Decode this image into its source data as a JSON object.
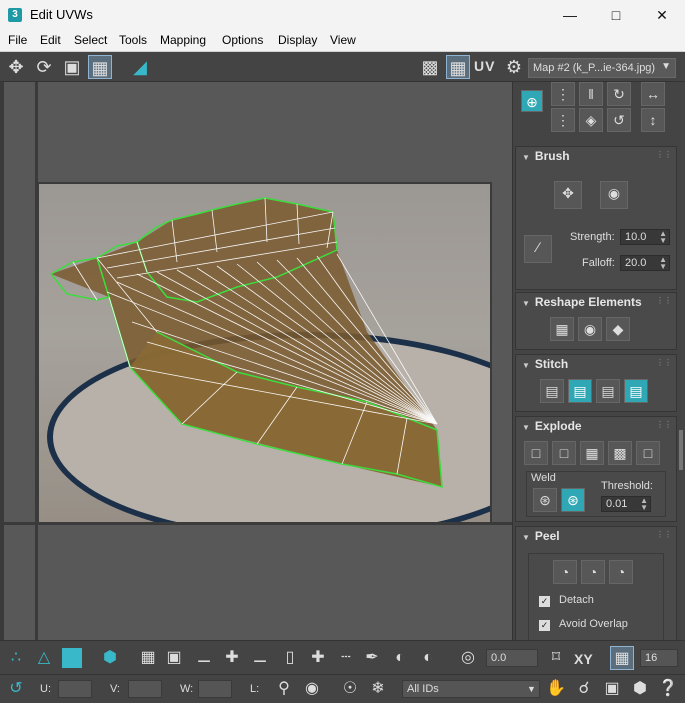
{
  "window": {
    "app_icon": "3",
    "title": "Edit UVWs",
    "minimize_icon": "minimize-icon",
    "maximize_icon": "maximize-icon",
    "close_icon": "close-icon"
  },
  "menu": {
    "items": [
      "File",
      "Edit",
      "Select",
      "Tools",
      "Mapping",
      "Options",
      "Display",
      "View"
    ]
  },
  "toolbar": {
    "uv_label": "UV",
    "map_dropdown": "Map #2 (k_P...ie-364.jpg)",
    "icons": [
      "move-icon",
      "rotate-icon",
      "scale-icon",
      "freeform-icon",
      "mirror-icon",
      "checker-icon",
      "checker-texture-icon",
      "settings-icon"
    ]
  },
  "rollouts": {
    "brush": {
      "title": "Brush",
      "strength_label": "Strength:",
      "strength_value": "10.0",
      "falloff_label": "Falloff:",
      "falloff_value": "20.0"
    },
    "reshape": {
      "title": "Reshape Elements"
    },
    "stitch": {
      "title": "Stitch"
    },
    "explode": {
      "title": "Explode",
      "weld_label": "Weld",
      "threshold_label": "Threshold:",
      "threshold_value": "0.01"
    },
    "peel": {
      "title": "Peel",
      "detach_label": "Detach",
      "detach_checked": true,
      "avoid_overlap_label": "Avoid Overlap",
      "avoid_overlap_checked": true
    }
  },
  "bottom": {
    "angle_value": "0.0",
    "xy_label": "XY",
    "grid_value": "16",
    "u_label": "U:",
    "v_label": "V:",
    "w_label": "W:",
    "l_label": "L:",
    "ids_dropdown": "All IDs"
  }
}
